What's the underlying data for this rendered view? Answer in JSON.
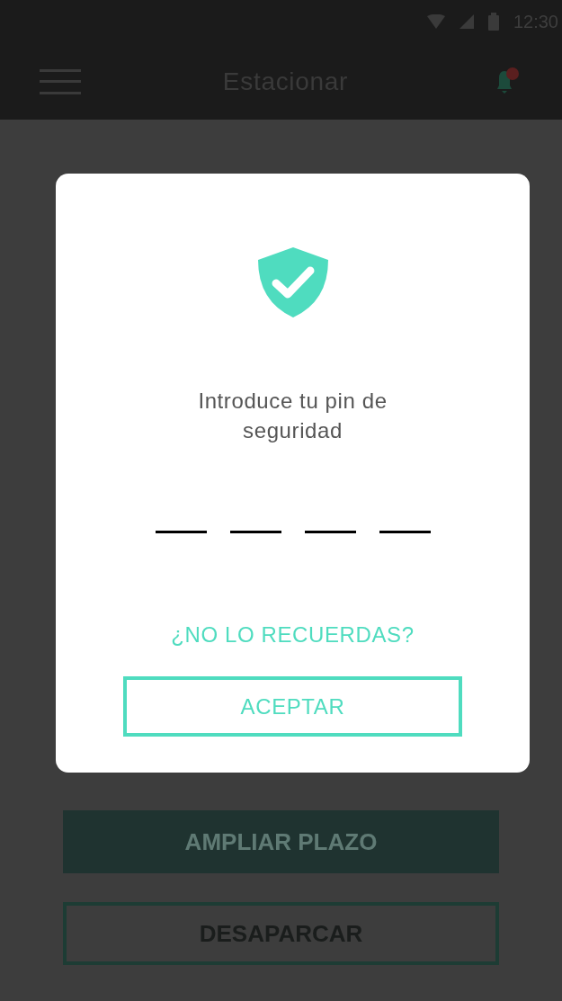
{
  "status_bar": {
    "time": "12:30"
  },
  "app_bar": {
    "title": "Estacionar",
    "notifications": {
      "unread": true
    }
  },
  "background_buttons": [
    {
      "label": "AMPLIAR PLAZO",
      "kind": "filled"
    },
    {
      "label": "DESAPARCAR",
      "kind": "outlined"
    }
  ],
  "dialog": {
    "title": "Introduce tu pin de seguridad",
    "pin_slots": [
      {
        "filled": false
      },
      {
        "filled": false
      },
      {
        "filled": false
      },
      {
        "filled": false
      }
    ],
    "link": "¿NO LO RECUERDAS?",
    "button": "ACEPTAR"
  }
}
